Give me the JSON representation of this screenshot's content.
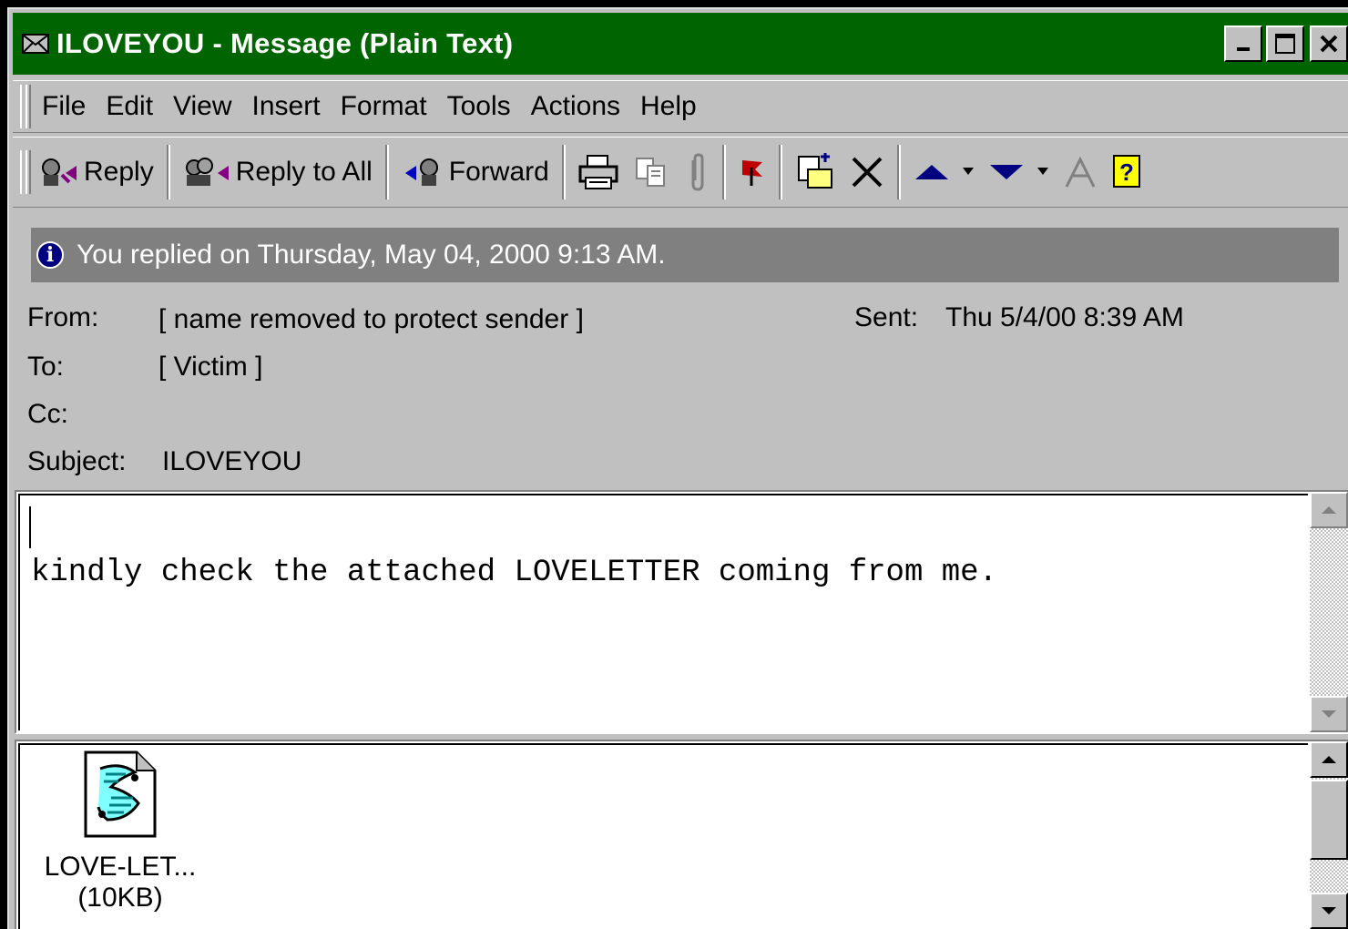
{
  "window": {
    "title": "ILOVEYOU - Message (Plain Text)"
  },
  "menu": [
    "File",
    "Edit",
    "View",
    "Insert",
    "Format",
    "Tools",
    "Actions",
    "Help"
  ],
  "toolbar": {
    "reply": "Reply",
    "reply_all": "Reply to All",
    "forward": "Forward"
  },
  "infobar": {
    "text": "You replied on Thursday, May 04, 2000 9:13 AM."
  },
  "header": {
    "from_label": "From:",
    "from_value": "[ name removed to protect sender ]",
    "sent_label": "Sent:",
    "sent_value": "Thu 5/4/00 8:39 AM",
    "to_label": "To:",
    "to_value": "[ Victim ]",
    "cc_label": "Cc:",
    "cc_value": "",
    "subject_label": "Subject:",
    "subject_value": "ILOVEYOU"
  },
  "body": {
    "text": "kindly check the attached LOVELETTER coming from me."
  },
  "attachment": {
    "name": "LOVE-LET...",
    "size": "(10KB)",
    "icon": "script-file-icon"
  },
  "colors": {
    "titlebar": "#006400",
    "infobar": "#808080",
    "face": "#c0c0c0"
  }
}
